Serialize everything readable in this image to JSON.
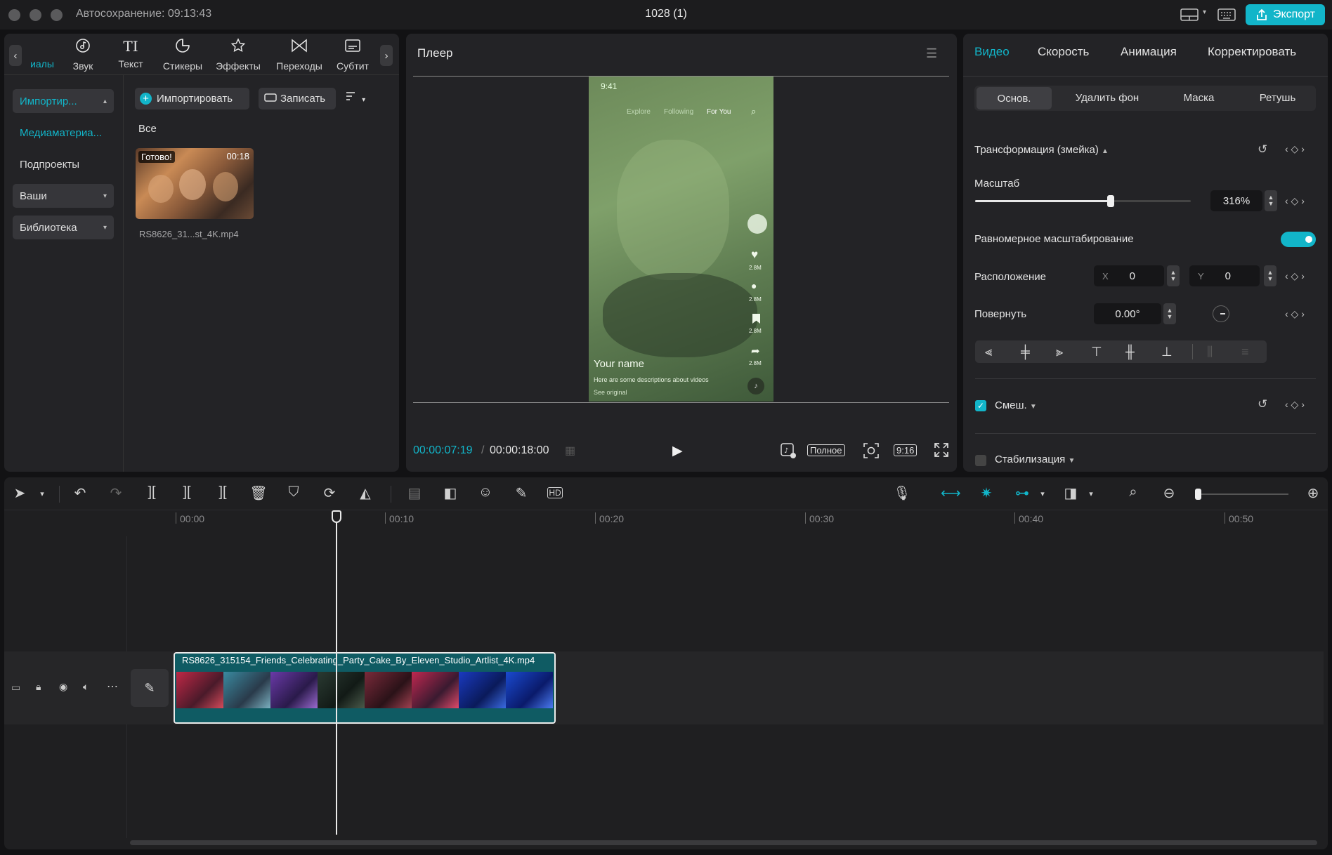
{
  "titlebar": {
    "autosave": "Автосохранение: 09:13:43",
    "title": "1028 (1)",
    "export_label": "Экспорт",
    "layout_icon": "layout-icon",
    "keyboard_icon": "keyboard-icon"
  },
  "media_toolbar": {
    "items": [
      {
        "label": "иалы",
        "icon": "media-icon"
      },
      {
        "label": "Звук",
        "icon": "audio-icon"
      },
      {
        "label": "Текст",
        "icon": "text-icon"
      },
      {
        "label": "Стикеры",
        "icon": "sticker-icon"
      },
      {
        "label": "Эффекты",
        "icon": "effects-icon"
      },
      {
        "label": "Переходы",
        "icon": "transitions-icon"
      },
      {
        "label": "Субтит",
        "icon": "subtitles-icon"
      }
    ]
  },
  "media_sidebar": {
    "import": "Импортир...",
    "media": "Медиаматериа...",
    "subprojects": "Подпроекты",
    "yours": "Ваши",
    "library": "Библиотека"
  },
  "media_content": {
    "import_btn": "Импортировать",
    "record_btn": "Записать",
    "filter_all": "Все",
    "clip": {
      "badge": "Готово!",
      "duration": "00:18",
      "filename": "RS8626_31...st_4K.mp4"
    }
  },
  "player": {
    "title": "Плеер",
    "current_time": "00:00:07:19",
    "total_time": "00:00:18:00",
    "quality": "Полное",
    "ratio": "9:16",
    "overlay": {
      "status_time": "9:41",
      "tabs": [
        "Explore",
        "Following",
        "For You"
      ],
      "counts": [
        "2.8M",
        "2.8M",
        "2.8M",
        "2.8M"
      ],
      "username": "Your name",
      "description": "Here are some descriptions about videos",
      "see_original": "See original"
    }
  },
  "properties": {
    "tabs": [
      "Видео",
      "Скорость",
      "Анимация",
      "Корректировать"
    ],
    "active_tab": "Видео",
    "subtabs": [
      "Основ.",
      "Удалить фон",
      "Маска",
      "Ретушь"
    ],
    "transform_header": "Трансформация (змейка)",
    "scale_label": "Масштаб",
    "scale_value": "316%",
    "scale_fraction": 0.63,
    "uniform_label": "Равномерное масштабирование",
    "uniform_on": true,
    "position_label": "Расположение",
    "x_label": "X",
    "x_value": "0",
    "y_label": "Y",
    "y_value": "0",
    "rotate_label": "Повернуть",
    "rotate_value": "0.00°",
    "blend_label": "Смеш.",
    "stabilize_label": "Стабилизация",
    "accent_color": "#12b5c9"
  },
  "timeline": {
    "ruler": [
      "00:00",
      "00:10",
      "00:20",
      "00:30",
      "00:40",
      "00:50"
    ],
    "clip_name": "RS8626_315154_Friends_Celebrating_Party_Cake_By_Eleven_Studio_Artlist_4K.mp4",
    "zoom_fraction": 0.0
  }
}
